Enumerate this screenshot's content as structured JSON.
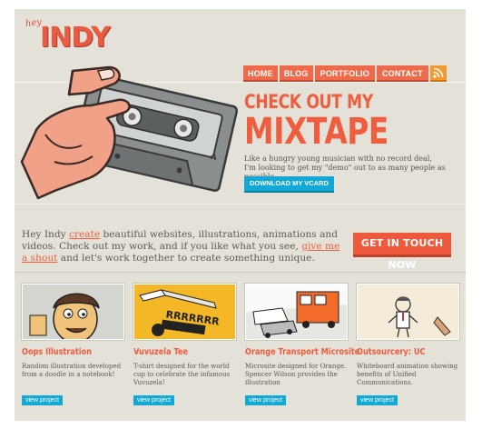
{
  "logo": {
    "small": "hey",
    "main": "INDY"
  },
  "nav": {
    "items": [
      "HOME",
      "BLOG",
      "PORTFOLIO",
      "CONTACT"
    ],
    "rss_icon": "rss-icon"
  },
  "hero": {
    "title_line1": "CHECK OUT MY",
    "title_line2": "MIXTAPE",
    "copy_line1": "Like a hungry young musician with no record deal,",
    "copy_line2": "I'm looking to get my \"demo\" out to as many people as possible.",
    "button": "DOWNLOAD MY VCARD"
  },
  "intro": {
    "t1": "Hey Indy ",
    "link1": "create",
    "t2": " beautiful websites, illustrations, animations and videos. Check out my work, and if you like what you see, ",
    "link2": "give me a shout",
    "t3": " and let's work together to create something unique."
  },
  "contact_button": "GET IN TOUCH NOW",
  "projects": [
    {
      "title": "Oops Illustration",
      "desc": "Random illustration developed from a doodle in a notebook!",
      "button": "view project"
    },
    {
      "title": "Vuvuzela Tee",
      "desc": "T-shirt designed for the world cup to celebrate the infamous Vuvuzela!",
      "button": "view project"
    },
    {
      "title": "Orange Transport Microsite",
      "desc": "Microsite designed for Orange. Spencer Wilson provides the illustration",
      "button": "view project"
    },
    {
      "title": "Outsourcery: UC",
      "desc": "Whiteboard animation showing benefits of Unified Communications.",
      "button": "view project"
    }
  ],
  "colors": {
    "accent": "#ef5d3f",
    "button_blue": "#14a8d4",
    "background": "#e3e1d8"
  }
}
